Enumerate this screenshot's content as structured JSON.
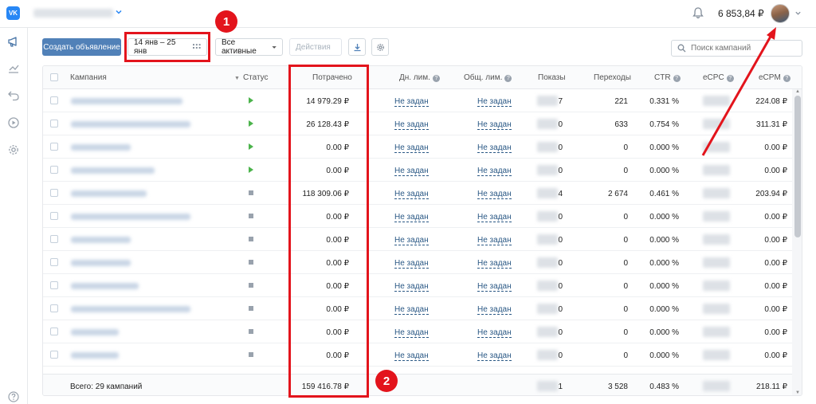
{
  "topbar": {
    "logo": "VK",
    "balance": "6 853,84 ₽"
  },
  "toolbar": {
    "create_label": "Создать объявление",
    "date_range": "14 янв – 25 янв",
    "filter_label": "Все активные",
    "actions_label": "Действия",
    "search_placeholder": "Поиск кампаний"
  },
  "table": {
    "headers": {
      "campaign": "Кампания",
      "status": "Статус",
      "spent": "Потрачено",
      "daily_limit": "Дн. лим.",
      "total_limit": "Общ. лим.",
      "impressions": "Показы",
      "clicks": "Переходы",
      "ctr": "CTR",
      "ecpc": "eCPC",
      "ecpm": "eCPM"
    },
    "rows": [
      {
        "status": "active",
        "spent": "14 979.29 ₽",
        "daily": "Не задан",
        "total": "Не задан",
        "impressions": "7",
        "clicks": "221",
        "ctr": "0.331 %",
        "ecpm": "224.08 ₽"
      },
      {
        "status": "active",
        "spent": "26 128.43 ₽",
        "daily": "Не задан",
        "total": "Не задан",
        "impressions": "0",
        "clicks": "633",
        "ctr": "0.754 %",
        "ecpm": "311.31 ₽"
      },
      {
        "status": "active",
        "spent": "0.00 ₽",
        "daily": "Не задан",
        "total": "Не задан",
        "impressions": "0",
        "clicks": "0",
        "ctr": "0.000 %",
        "ecpm": "0.00 ₽"
      },
      {
        "status": "active",
        "spent": "0.00 ₽",
        "daily": "Не задан",
        "total": "Не задан",
        "impressions": "0",
        "clicks": "0",
        "ctr": "0.000 %",
        "ecpm": "0.00 ₽"
      },
      {
        "status": "stopped",
        "spent": "118 309.06 ₽",
        "daily": "Не задан",
        "total": "Не задан",
        "impressions": "4",
        "clicks": "2 674",
        "ctr": "0.461 %",
        "ecpm": "203.94 ₽"
      },
      {
        "status": "stopped",
        "spent": "0.00 ₽",
        "daily": "Не задан",
        "total": "Не задан",
        "impressions": "0",
        "clicks": "0",
        "ctr": "0.000 %",
        "ecpm": "0.00 ₽"
      },
      {
        "status": "stopped",
        "spent": "0.00 ₽",
        "daily": "Не задан",
        "total": "Не задан",
        "impressions": "0",
        "clicks": "0",
        "ctr": "0.000 %",
        "ecpm": "0.00 ₽"
      },
      {
        "status": "stopped",
        "spent": "0.00 ₽",
        "daily": "Не задан",
        "total": "Не задан",
        "impressions": "0",
        "clicks": "0",
        "ctr": "0.000 %",
        "ecpm": "0.00 ₽"
      },
      {
        "status": "stopped",
        "spent": "0.00 ₽",
        "daily": "Не задан",
        "total": "Не задан",
        "impressions": "0",
        "clicks": "0",
        "ctr": "0.000 %",
        "ecpm": "0.00 ₽"
      },
      {
        "status": "stopped",
        "spent": "0.00 ₽",
        "daily": "Не задан",
        "total": "Не задан",
        "impressions": "0",
        "clicks": "0",
        "ctr": "0.000 %",
        "ecpm": "0.00 ₽"
      },
      {
        "status": "stopped",
        "spent": "0.00 ₽",
        "daily": "Не задан",
        "total": "Не задан",
        "impressions": "0",
        "clicks": "0",
        "ctr": "0.000 %",
        "ecpm": "0.00 ₽"
      },
      {
        "status": "stopped",
        "spent": "0.00 ₽",
        "daily": "Не задан",
        "total": "Не задан",
        "impressions": "0",
        "clicks": "0",
        "ctr": "0.000 %",
        "ecpm": "0.00 ₽"
      }
    ],
    "footer": {
      "total_label": "Всего: 29 кампаний",
      "spent": "159 416.78 ₽",
      "impressions": "1",
      "clicks": "3 528",
      "ctr": "0.483 %",
      "ecpm": "218.11 ₽"
    }
  },
  "annotations": {
    "badge_1": "1",
    "badge_2": "2"
  },
  "colors": {
    "accent": "#5181b8",
    "link": "#2a5885",
    "annotation": "#e3141c",
    "status_active": "#4bb34b",
    "status_stopped": "#99a2ad"
  }
}
